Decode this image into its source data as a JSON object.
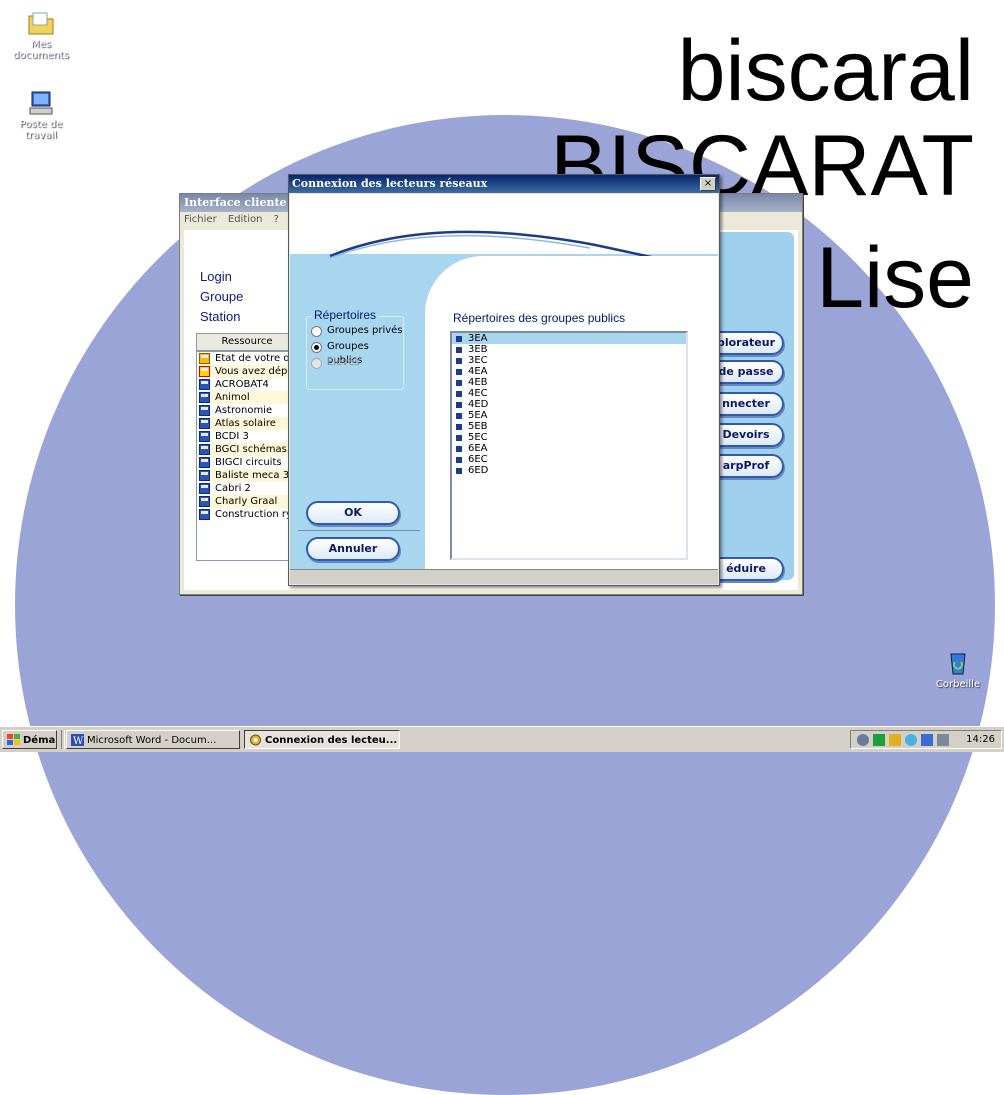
{
  "desktop": {
    "wallpaper_lines": [
      "biscaral",
      "BISCARAT",
      "Lise"
    ],
    "icons": [
      {
        "label": "Mes documents",
        "icon": "folder-icon"
      },
      {
        "label": "Poste de travail",
        "icon": "computer-icon"
      },
      {
        "label": "Corbeille",
        "icon": "recycle-bin-icon"
      }
    ]
  },
  "app_window": {
    "title": "Interface cliente de",
    "menu": [
      "Fichier",
      "Edition",
      "?"
    ],
    "labels": [
      "Login",
      "Groupe",
      "Station"
    ],
    "resource_header": "Ressource",
    "resources": [
      "Etat de votre q",
      "Vous avez dép",
      "ACROBAT4",
      "Animol",
      "Astronomie",
      "Atlas solaire",
      "BCDI 3",
      "BGCI schémas",
      "BIGCI circuits",
      "Baliste meca 3",
      "Cabri 2",
      "Charly Graal",
      "Construction ry"
    ],
    "buttons": [
      "plorateur",
      "de passe",
      "nnecter",
      "Devoirs",
      "arpProf",
      "éduire"
    ]
  },
  "dialog": {
    "title": "Connexion des lecteurs réseaux",
    "close_label": "×",
    "group_legend": "Répertoires",
    "radios": [
      {
        "label": "Groupes privés",
        "checked": false,
        "disabled": false
      },
      {
        "label": "Groupes publics",
        "checked": true,
        "disabled": false
      },
      {
        "label": "Elèves",
        "checked": false,
        "disabled": true
      }
    ],
    "list_title": "Répertoires des groupes publics",
    "repos": [
      "3EA",
      "3EB",
      "3EC",
      "4EA",
      "4EB",
      "4EC",
      "4ED",
      "5EA",
      "5EB",
      "5EC",
      "6EA",
      "6EC",
      "6ED"
    ],
    "selected_repo": "3EA",
    "ok_label": "OK",
    "cancel_label": "Annuler"
  },
  "taskbar": {
    "start_label": "Démarrer",
    "tasks": [
      {
        "label": "Microsoft Word - Docum...",
        "active": false
      },
      {
        "label": "Connexion des lecteu...",
        "active": true
      }
    ],
    "clock": "14:26"
  }
}
